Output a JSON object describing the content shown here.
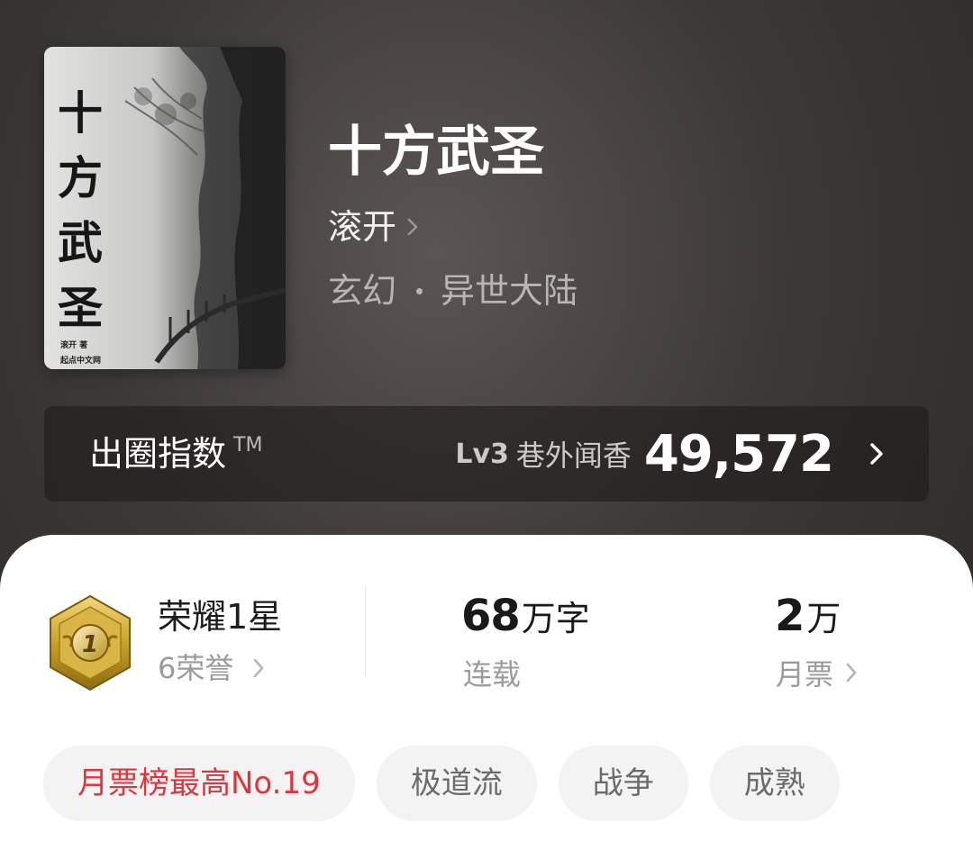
{
  "cover": {
    "title_chars": [
      "十",
      "方",
      "武",
      "圣"
    ],
    "author": "滚开 著",
    "publisher": "起点中文网"
  },
  "book": {
    "title": "十方武圣",
    "author": "滚开",
    "category": "玄幻",
    "subcategory": "异世大陆"
  },
  "index_bar": {
    "label": "出圈指数",
    "trademark": "TM",
    "level": "Lv3",
    "rank_name": "巷外闻香",
    "value": "49,572"
  },
  "honor": {
    "title": "荣耀1星",
    "subtitle": "6荣誉",
    "badge_number": "1"
  },
  "stats": {
    "words_number": "68",
    "words_unit": "万字",
    "words_label": "连载",
    "tickets_number": "2",
    "tickets_unit": "万",
    "tickets_label": "月票"
  },
  "tags": [
    {
      "label": "月票榜最高No.19",
      "highlight": true
    },
    {
      "label": "极道流",
      "highlight": false
    },
    {
      "label": "战争",
      "highlight": false
    },
    {
      "label": "成熟",
      "highlight": false
    }
  ],
  "colors": {
    "header_bg": "#3d3937",
    "highlight_tag": "#e0353d",
    "badge_gold": "#c9a227"
  },
  "icons": {
    "author_chevron": "chevron-right-icon",
    "index_chevron": "chevron-right-icon",
    "honor_badge": "honor-star-badge-icon"
  }
}
